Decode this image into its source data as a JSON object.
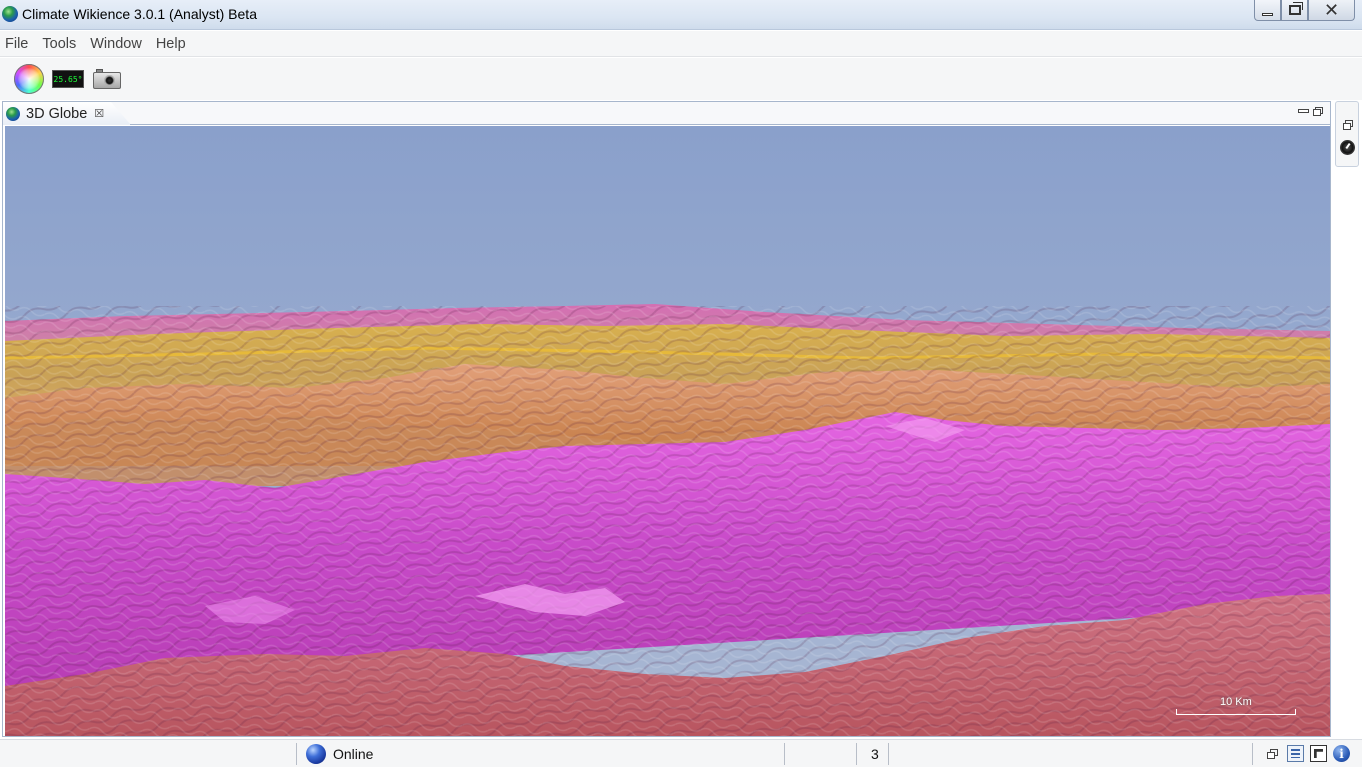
{
  "window": {
    "title": "Climate Wikience 3.0.1 (Analyst) Beta",
    "controls": {
      "minimize": "minimize",
      "maximize": "restore",
      "close": "close"
    }
  },
  "menu": {
    "items": [
      {
        "label": "File"
      },
      {
        "label": "Tools"
      },
      {
        "label": "Window"
      },
      {
        "label": "Help"
      }
    ]
  },
  "toolbar": {
    "items": [
      {
        "name": "color-wheel-icon"
      },
      {
        "name": "temperature-display",
        "value": "25.65°"
      },
      {
        "name": "camera-icon"
      }
    ]
  },
  "view": {
    "tab_label": "3D Globe",
    "tab_close": "☒",
    "scale_bar_label": "10 Km",
    "colors": {
      "sky_top": "#8aa1cc",
      "sky_horizon": "#a8b7d4",
      "terrain_magenta": "#d24fd2",
      "terrain_orange": "#d7935a",
      "terrain_yellow": "#d4b35a"
    }
  },
  "statusbar": {
    "connection_label": "Online",
    "count_label": "3",
    "info_glyph": "i"
  }
}
